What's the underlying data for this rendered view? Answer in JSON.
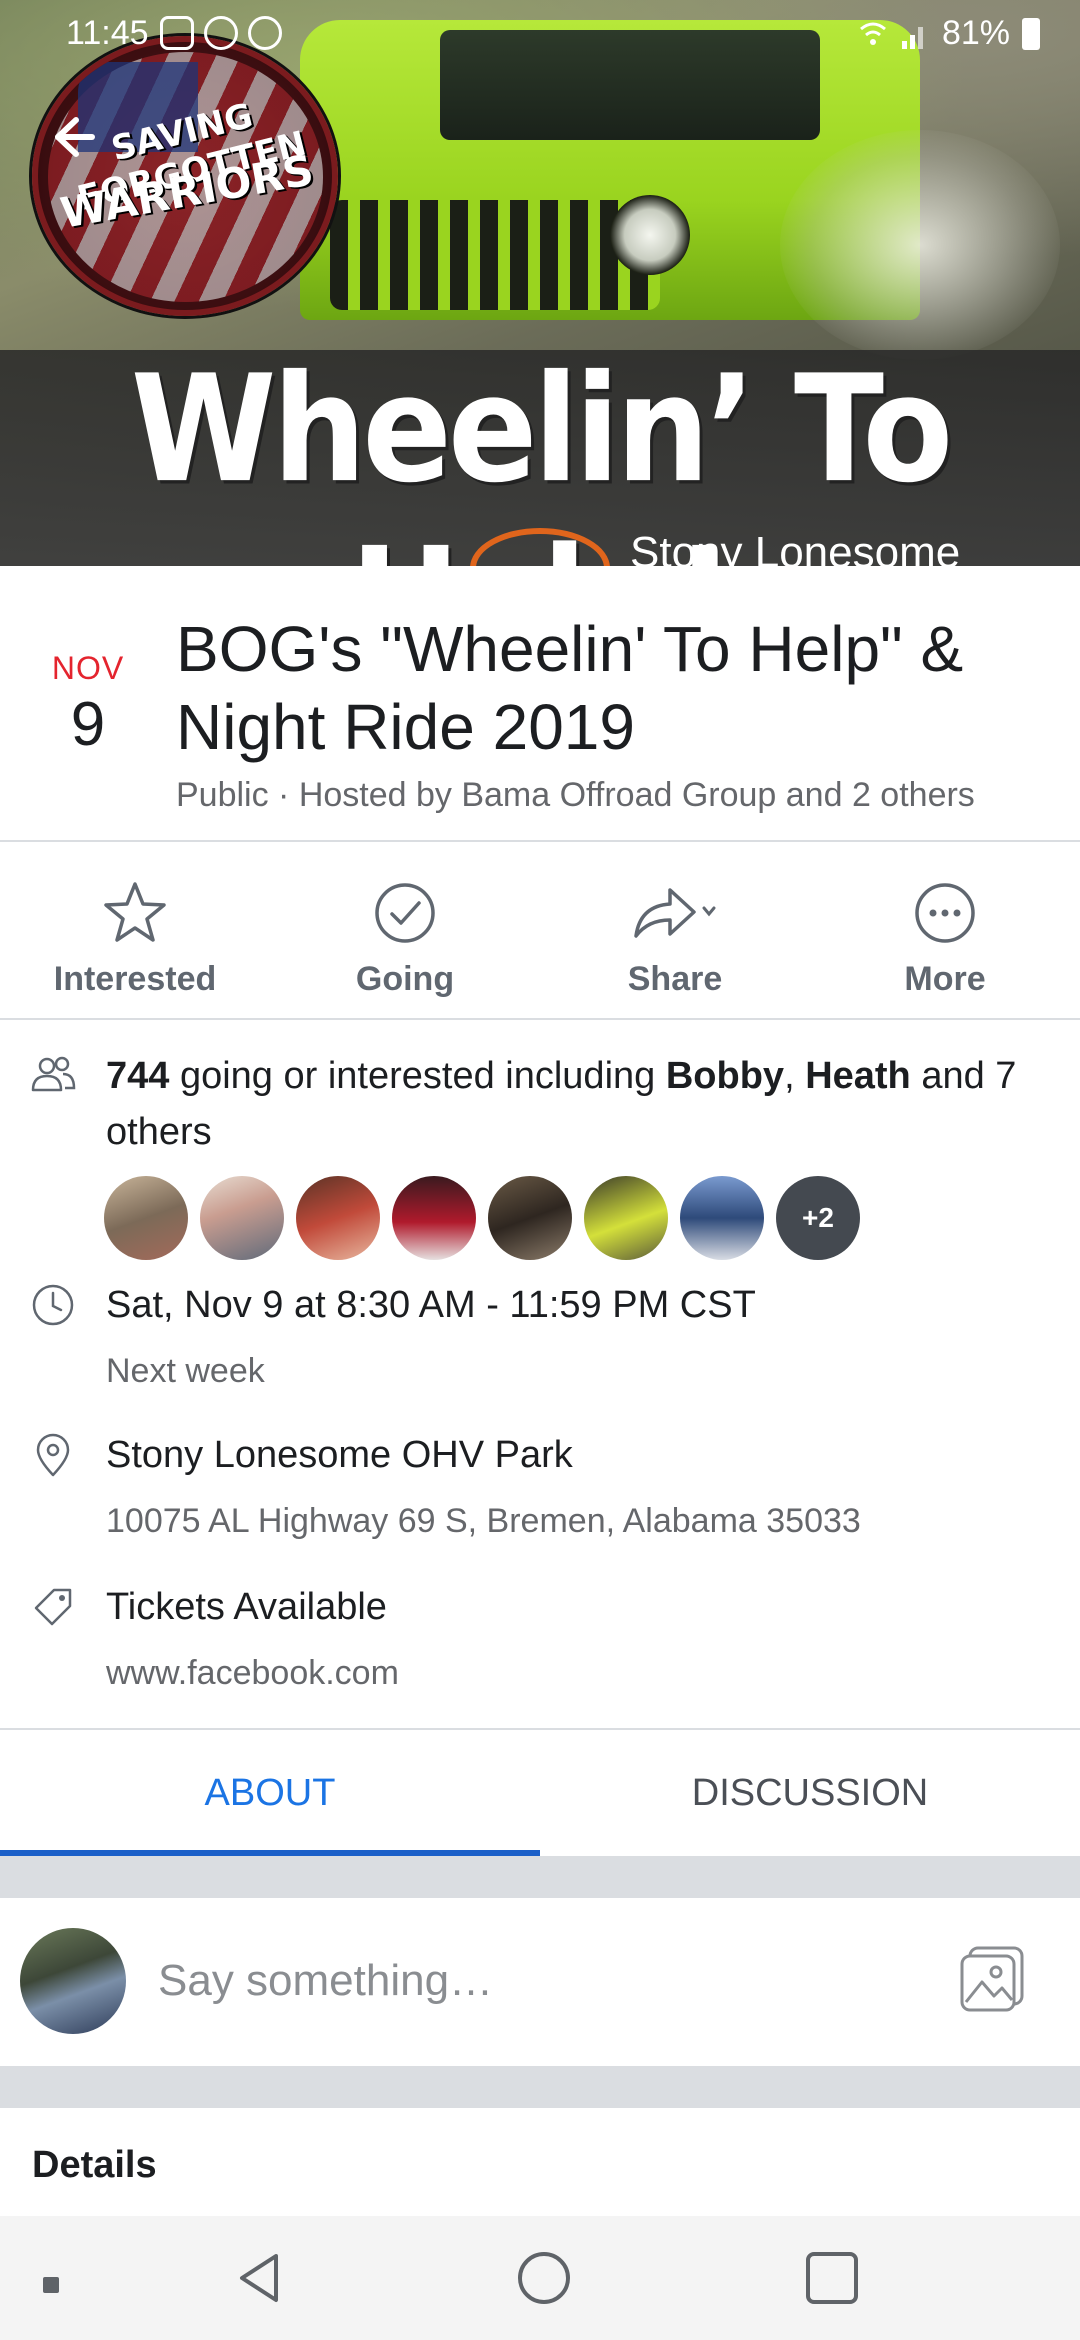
{
  "status_bar": {
    "time": "11:45",
    "battery": "81%"
  },
  "cover": {
    "banner_text": "Wheelin’ To Help!",
    "banner_subtext": "Stony Lonesome",
    "badge_line1": "SAVING FORGOTTEN",
    "badge_line2": "WARRIORS"
  },
  "event": {
    "month": "NOV",
    "day": "9",
    "title": "BOG's \"Wheelin' To Help\" & Night Ride 2019",
    "subtitle": "Public · Hosted by Bama Offroad Group and 2 others"
  },
  "actions": [
    {
      "label": "Interested",
      "icon": "star-icon"
    },
    {
      "label": "Going",
      "icon": "check-circle-icon"
    },
    {
      "label": "Share",
      "icon": "share-arrow-icon"
    },
    {
      "label": "More",
      "icon": "more-dots-icon"
    }
  ],
  "attendance": {
    "count": "744",
    "text_a": " going or interested including ",
    "name1": "Bobby",
    "sep": ", ",
    "name2": "Heath",
    "text_b": " and 7 others",
    "extra": "+2"
  },
  "schedule": {
    "time": "Sat, Nov 9 at 8:30 AM - 11:59 PM CST",
    "relative": "Next week"
  },
  "location": {
    "name": "Stony Lonesome OHV Park",
    "address": "10075 AL Highway 69 S, Bremen, Alabama 35033"
  },
  "tickets": {
    "label": "Tickets Available",
    "url": "www.facebook.com"
  },
  "tabs": [
    {
      "label": "ABOUT",
      "active": true
    },
    {
      "label": "DISCUSSION",
      "active": false
    }
  ],
  "composer": {
    "placeholder": "Say something…"
  },
  "details": {
    "title": "Details"
  },
  "colors": {
    "accent": "#1b74e4",
    "month_red": "#e4242e",
    "secondary_text": "#65676b"
  }
}
